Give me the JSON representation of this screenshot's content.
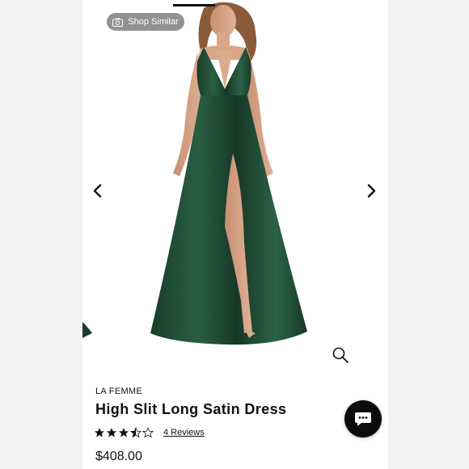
{
  "shop_similar": {
    "label": "Shop Similar",
    "icon": "camera-icon"
  },
  "gallery": {
    "prev_icon": "chevron-left-icon",
    "next_icon": "chevron-right-icon",
    "zoom_icon": "magnifier-icon",
    "dress_color": "#1f4a33"
  },
  "product": {
    "brand": "LA FEMME",
    "title": "High Slit Long Satin Dress",
    "rating": 3.5,
    "rating_max": 5,
    "reviews_label": "4 Reviews",
    "price": "$408.00"
  },
  "chat": {
    "icon": "chat-bubble-icon"
  }
}
